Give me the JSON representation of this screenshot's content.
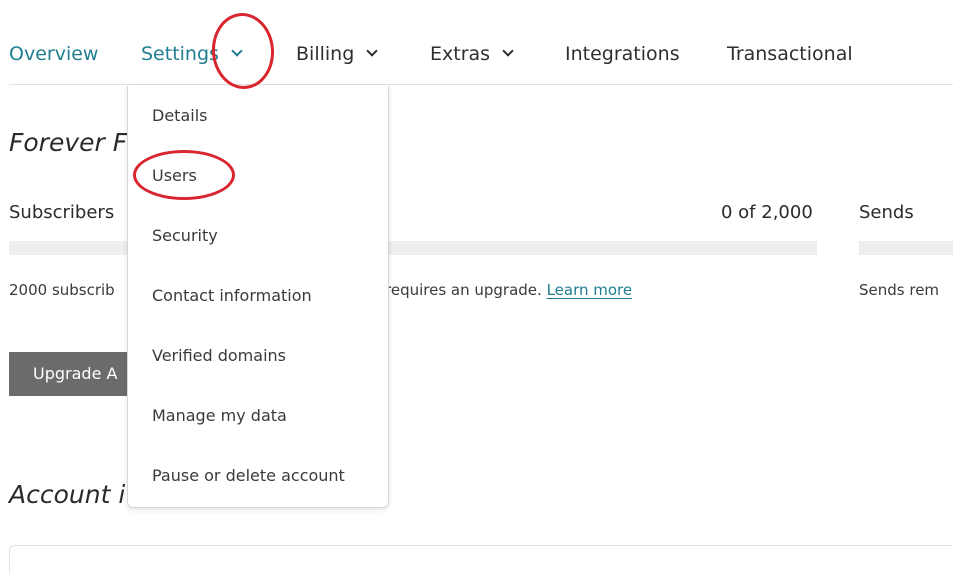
{
  "nav": {
    "items": [
      {
        "label": "Overview",
        "dropdown": false
      },
      {
        "label": "Settings",
        "dropdown": true
      },
      {
        "label": "Billing",
        "dropdown": true
      },
      {
        "label": "Extras",
        "dropdown": true
      },
      {
        "label": "Integrations",
        "dropdown": false
      },
      {
        "label": "Transactional",
        "dropdown": false
      }
    ]
  },
  "settings_menu": {
    "items": [
      "Details",
      "Users",
      "Security",
      "Contact information",
      "Verified domains",
      "Manage my data",
      "Pause or delete account"
    ]
  },
  "plan": {
    "title": "Forever F",
    "subscribers_label": "Subscribers",
    "subscribers_count": "0 of 2,000",
    "subscribers_used_fraction": 0,
    "sends_label": "Sends",
    "note_left": "2000 subscrib",
    "note_right": "requires an upgrade. ",
    "learn_more": "Learn more",
    "sends_note": "Sends rem",
    "upgrade_button": "Upgrade A"
  },
  "account": {
    "title": "Account i"
  },
  "colors": {
    "accent": "#1f7e90",
    "annotation": "#d9252d",
    "button": "#6b6b6b"
  }
}
